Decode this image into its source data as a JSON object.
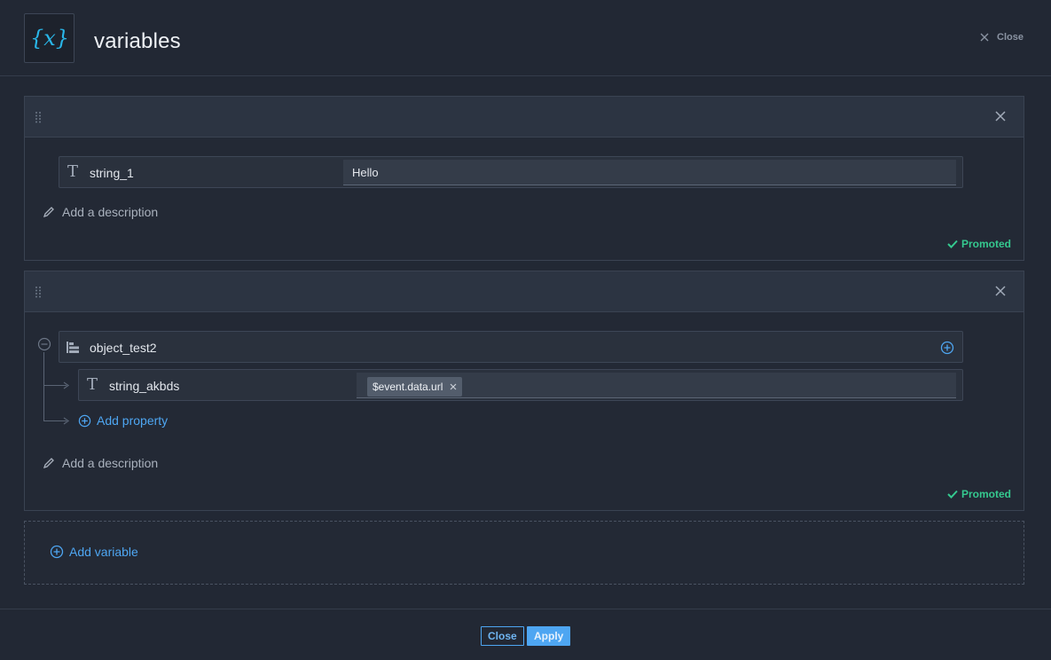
{
  "header": {
    "title": "variables",
    "logo_glyph": "{x}",
    "close_label": "Close"
  },
  "variables": [
    {
      "name": "string_1",
      "type_icon": "T",
      "value": "Hello",
      "description_placeholder": "Add a description",
      "status": "Promoted"
    },
    {
      "name": "object_test2",
      "properties": [
        {
          "name": "string_akbds",
          "type_icon": "T",
          "value_chip": "$event.data.url"
        }
      ],
      "add_property_label": "Add property",
      "description_placeholder": "Add a description",
      "status": "Promoted"
    }
  ],
  "add_variable_label": "Add variable",
  "footer": {
    "close_label": "Close",
    "apply_label": "Apply"
  },
  "colors": {
    "accent": "#4ea6f2",
    "success": "#35c98f",
    "logo": "#29b6e8"
  }
}
